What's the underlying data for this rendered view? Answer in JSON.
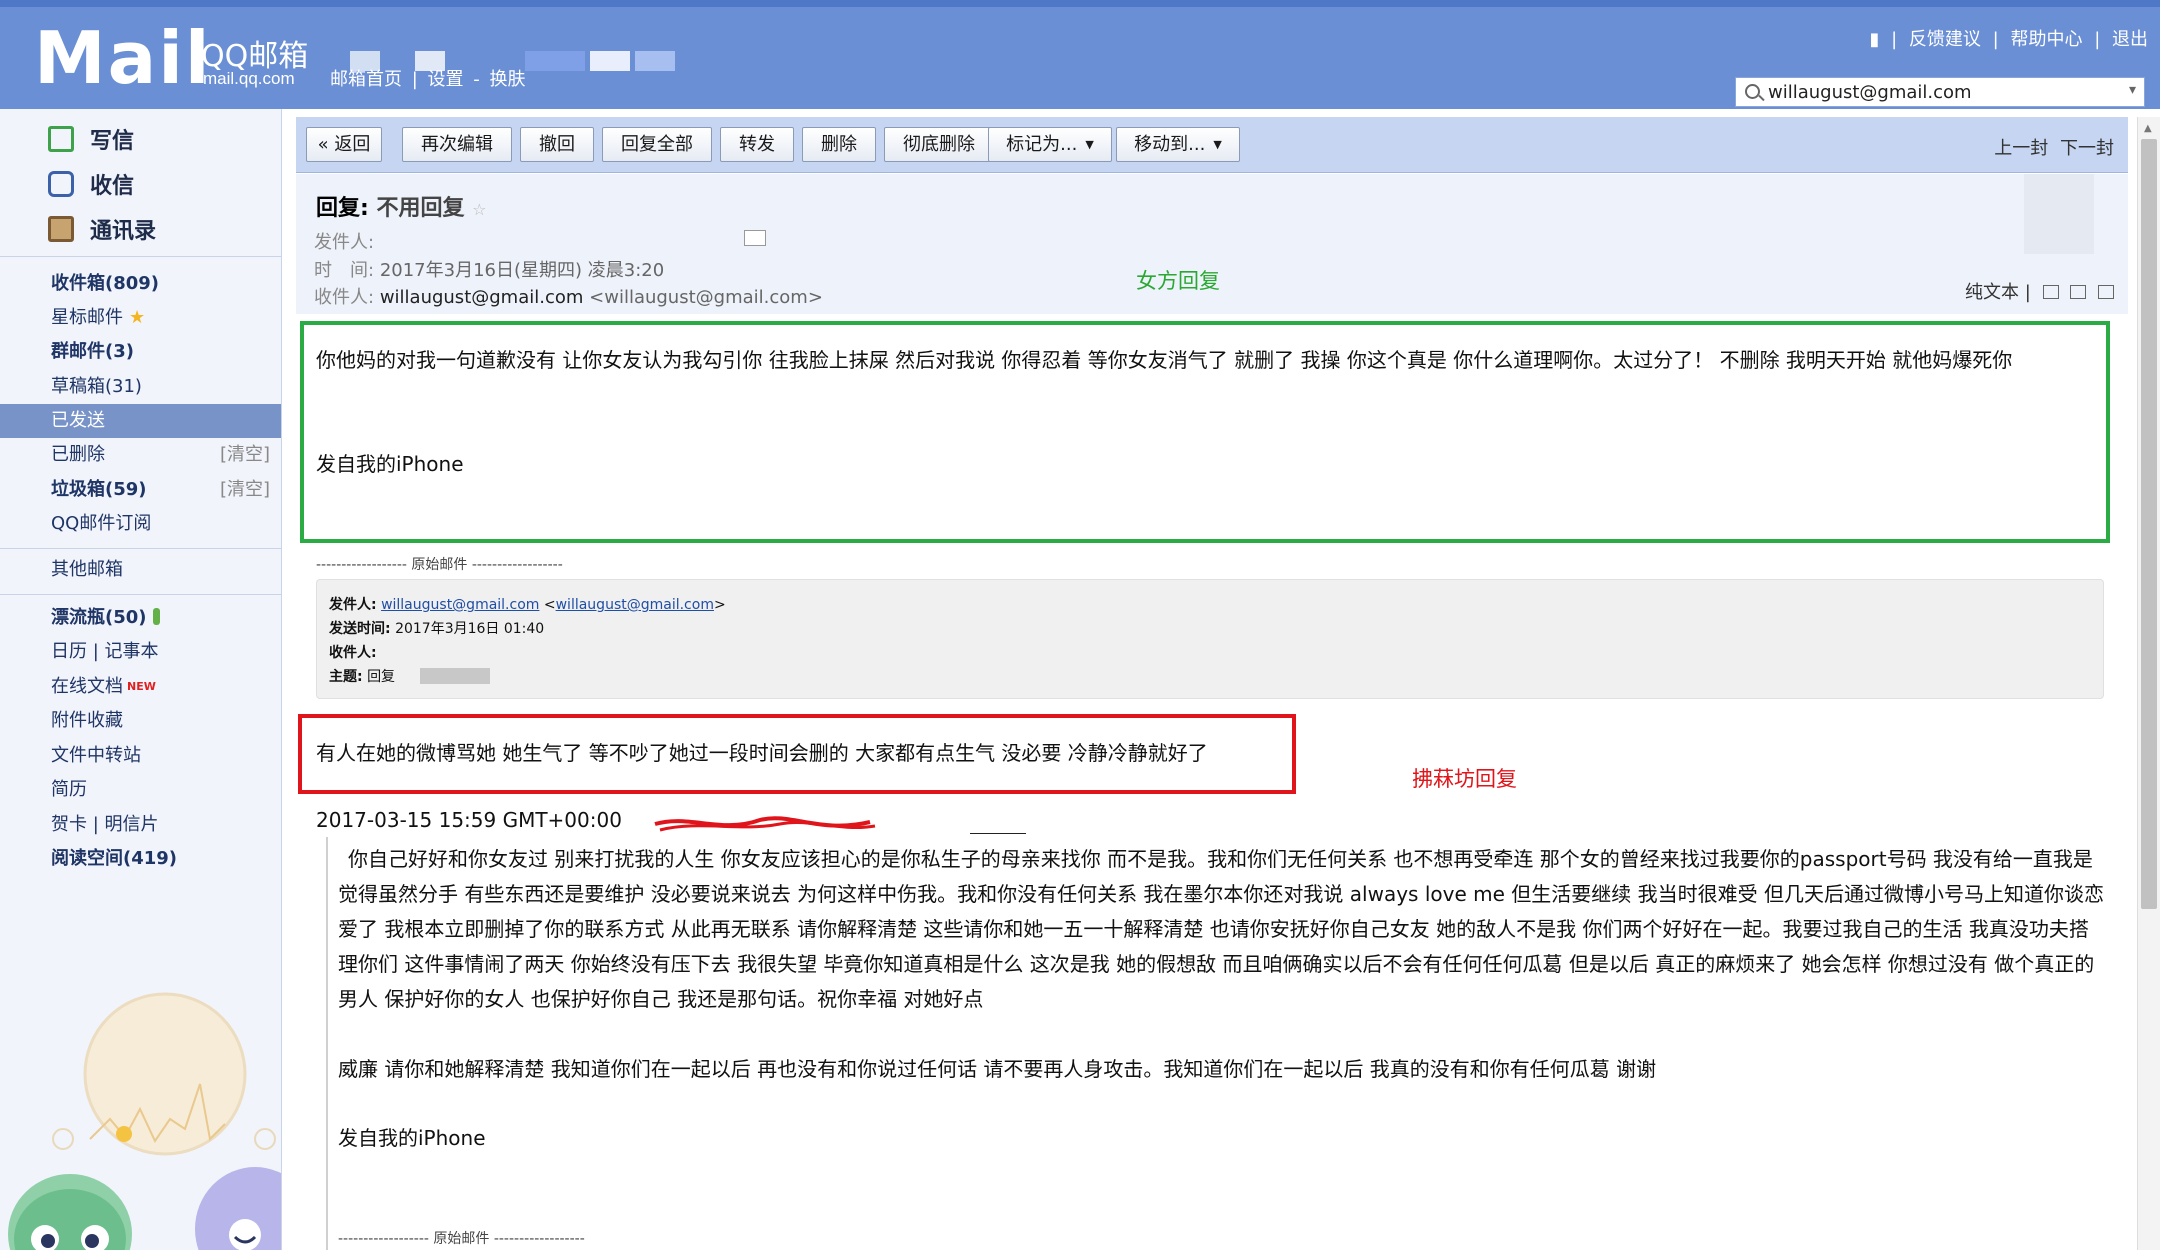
{
  "header": {
    "logo_text": "Mail",
    "brand": "QQ邮箱",
    "site": "mail.qq.com",
    "links": [
      "邮箱首页",
      "|",
      "设置",
      "-",
      "换肤"
    ],
    "top_right_links": [
      "|",
      "反馈建议",
      "|",
      "帮助中心",
      "|",
      "退出"
    ],
    "account": "willaugust@gmail.com"
  },
  "sidebar": {
    "actions": [
      {
        "label": "写信",
        "icon": "compose-icon"
      },
      {
        "label": "收信",
        "icon": "inbox-icon"
      },
      {
        "label": "通讯录",
        "icon": "contacts-icon"
      }
    ],
    "folders": [
      {
        "label": "收件箱(809)",
        "bold": true
      },
      {
        "label": "星标邮件",
        "star": true
      },
      {
        "label": "群邮件(3)",
        "bold": true
      },
      {
        "label": "草稿箱(31)"
      },
      {
        "label": "已发送",
        "active": true
      },
      {
        "label": "已删除",
        "clear": "[清空]"
      },
      {
        "label": "垃圾箱(59)",
        "bold": true,
        "clear": "[清空]"
      },
      {
        "label": "QQ邮件订阅"
      }
    ],
    "other": "其他邮箱",
    "tools": [
      {
        "label": "漂流瓶(50)",
        "bold": true
      },
      {
        "label": "日历  |  记事本"
      },
      {
        "label": "在线文档",
        "new": "NEW"
      },
      {
        "label": "附件收藏"
      },
      {
        "label": "文件中转站"
      },
      {
        "label": "简历"
      },
      {
        "label": "贺卡  |  明信片"
      },
      {
        "label": "阅读空间(419)",
        "bold": true
      }
    ]
  },
  "toolbar": {
    "back": "« 返回",
    "buttons": [
      "再次编辑",
      "撤回",
      "回复全部",
      "转发",
      "删除",
      "彻底删除"
    ],
    "mark_as": "标记为...",
    "move_to": "移动到...",
    "prev_next": [
      "上一封",
      "下一封"
    ]
  },
  "mail": {
    "subject_prefix": "回复:",
    "subject_rest": "不用回复",
    "from_label": "发件人:",
    "time_label": "时　间:",
    "time_value": "2017年3月16日(星期四) 凌晨3:20",
    "to_label": "收件人:",
    "to_value": "willaugust@gmail.com",
    "to_value_addr": "<willaugust@gmail.com>",
    "plain_text": "纯文本  |",
    "annot_green": "女方回复",
    "reply_body": "你他妈的对我一句道歉没有 让你女友认为我勾引你 往我脸上抹屎 然后对我说 你得忍着 等你女友消气了 就删了 我操 你这个真是 你什么道理啊你。太过分了！ 不删除 我明天开始 就他妈爆死你",
    "signature": "发自我的iPhone",
    "orig_divider": "------------------ 原始邮件 ------------------",
    "quote": {
      "from_label": "发件人:",
      "from_name": "willaugust@gmail.com",
      "from_addr": "willaugust@gmail.com",
      "sent_label": "发送时间:",
      "sent_value": "2017年3月16日 01:40",
      "to_label": "收件人:",
      "subject_label": "主题:",
      "subject_value": "回复"
    },
    "red_reply": "有人在她的微博骂她 她生气了 等不吵了她过一段时间会删的 大家都有点生气 没必要 冷静冷静就好了",
    "annot_red": "拂菻坊回复",
    "gmt_line": "2017-03-15 15:59 GMT+00:00",
    "para1": "你自己好好和你女友过 别来打扰我的人生 你女友应该担心的是你私生子的母亲来找你 而不是我。我和你们无任何关系 也不想再受牵连 那个女的曾经来找过我要你的passport号码 我没有给一直我是觉得虽然分手 有些东西还是要维护 没必要说来说去 为何这样中伤我。我和你没有任何关系 我在墨尔本你还对我说 always love me 但生活要继续 我当时很难受 但几天后通过微博小号马上知道你谈恋爱了 我根本立即删掉了你的联系方式  从此再无联系 请你解释清楚 这些请你和她一五一十解释清楚 也请你安抚好你自己女友 她的敌人不是我  你们两个好好在一起。我要过我自己的生活 我真没功夫搭理你们  这件事情闹了两天 你始终没有压下去 我很失望 毕竟你知道真相是什么 这次是我 她的假想敌 而且咱俩确实以后不会有任何任何瓜葛  但是以后 真正的麻烦来了 她会怎样 你想过没有 做个真正的男人 保护好你的女人 也保护好你自己 我还是那句话。祝你幸福 对她好点",
    "para2": "威廉 请你和她解释清楚 我知道你们在一起以后 再也没有和你说过任何话  请不要再人身攻击。我知道你们在一起以后 我真的没有和你有任何瓜葛 谢谢",
    "para3": "发自我的iPhone",
    "orig_divider2": "------------------ 原始邮件 ------------------"
  },
  "colors": {
    "header_bg": "#6a8fd4",
    "green_box": "#2bab43",
    "red_box": "#e0151b",
    "sidebar_active": "#7893c8"
  }
}
